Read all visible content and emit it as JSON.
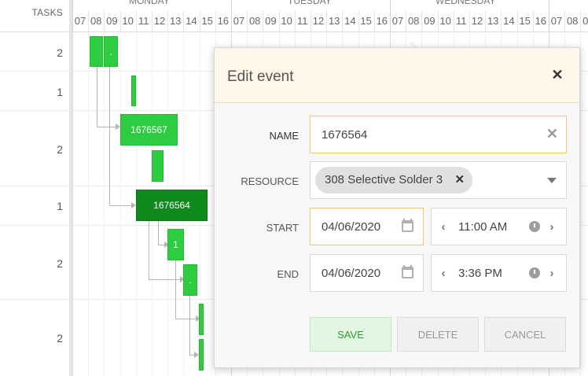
{
  "gantt": {
    "tasks_header": "TASKS",
    "days": [
      "MONDAY",
      "TUESDAY",
      "WEDNESDAY"
    ],
    "hours": [
      "07",
      "08",
      "09",
      "10",
      "11",
      "12",
      "13",
      "14",
      "15",
      "16"
    ],
    "row_counts": [
      "2",
      "1",
      "2",
      "1",
      "2",
      "2"
    ],
    "bars": [
      {
        "label": ""
      },
      {
        "label": "."
      },
      {
        "label": ""
      },
      {
        "label": "1676567"
      },
      {
        "label": ""
      },
      {
        "label": "1676564"
      },
      {
        "label": "1"
      },
      {
        "label": "."
      },
      {
        "label": ""
      },
      {
        "label": ""
      }
    ],
    "colors": {
      "bar": "#2ecc40",
      "selected_bar": "#0f8a1c"
    }
  },
  "dialog": {
    "title": "Edit event",
    "name_label": "NAME",
    "name_value": "1676564",
    "resource_label": "RESOURCE",
    "resource_value": "308 Selective Solder 3",
    "start_label": "START",
    "start_date": "04/06/2020",
    "start_time": "11:00 AM",
    "end_label": "END",
    "end_date": "04/06/2020",
    "end_time": "3:36 PM",
    "save_label": "SAVE",
    "delete_label": "DELETE",
    "cancel_label": "CANCEL",
    "close_glyph": "✕",
    "clear_glyph": "✕",
    "chip_remove_glyph": "✕",
    "prev_glyph": "‹",
    "next_glyph": "›"
  }
}
